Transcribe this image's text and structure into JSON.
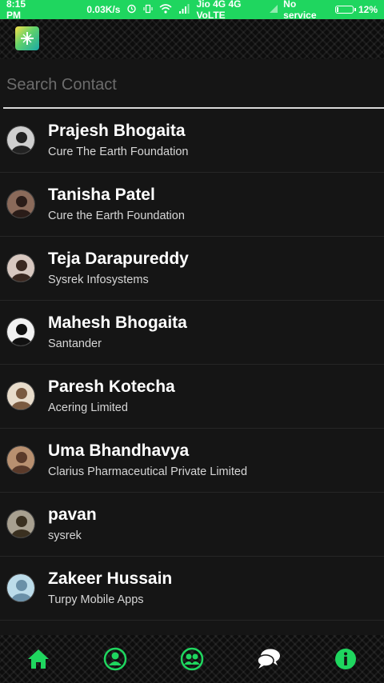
{
  "status_bar": {
    "time": "8:15 PM",
    "speed": "0.03K/s",
    "network": "Jio 4G 4G VoLTE",
    "service": "No service",
    "battery": "12%",
    "battery_level": 0.12
  },
  "search": {
    "placeholder": "Search Contact"
  },
  "contacts": [
    {
      "name": "Prajesh Bhogaita",
      "company": "Cure The Earth Foundation",
      "avatar_color": "#cfcfcf",
      "avatar_fg": "#222222"
    },
    {
      "name": "Tanisha Patel",
      "company": "Cure the Earth Foundation",
      "avatar_color": "#8a6a5a",
      "avatar_fg": "#2a1c18"
    },
    {
      "name": "Teja Darapureddy",
      "company": "Sysrek Infosystems",
      "avatar_color": "#d8c8c0",
      "avatar_fg": "#3a2820"
    },
    {
      "name": "Mahesh Bhogaita",
      "company": "Santander",
      "avatar_color": "#f2f2f2",
      "avatar_fg": "#111111"
    },
    {
      "name": "Paresh Kotecha",
      "company": "Acering Limited",
      "avatar_color": "#e8dccb",
      "avatar_fg": "#7a5a40"
    },
    {
      "name": "Uma Bhandhavya",
      "company": "Clarius Pharmaceutical Private Limited",
      "avatar_color": "#b89070",
      "avatar_fg": "#5a3a2a"
    },
    {
      "name": "pavan",
      "company": "sysrek",
      "avatar_color": "#a8a090",
      "avatar_fg": "#3a3020"
    },
    {
      "name": "Zakeer Hussain",
      "company": "Turpy Mobile Apps",
      "avatar_color": "#bcdcea",
      "avatar_fg": "#6a90a8"
    }
  ],
  "nav": [
    {
      "icon": "home-icon"
    },
    {
      "icon": "contact-icon"
    },
    {
      "icon": "groups-icon"
    },
    {
      "icon": "chat-icon"
    },
    {
      "icon": "info-icon"
    }
  ],
  "colors": {
    "accent": "#1fd65f",
    "background": "#151515",
    "text": "#ffffff"
  }
}
